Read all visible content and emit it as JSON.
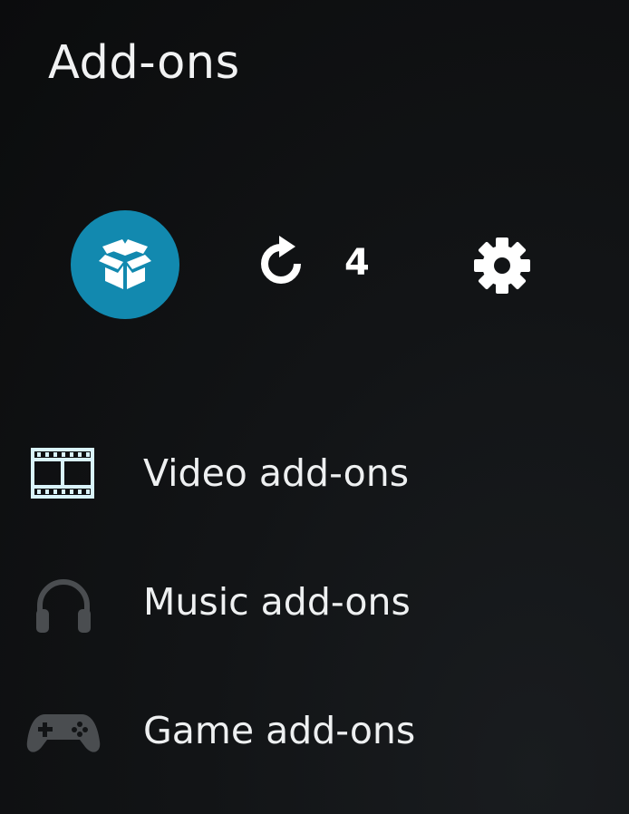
{
  "header": {
    "title": "Add-ons"
  },
  "toolbar": {
    "addon_browser_icon": "open-box-icon",
    "update_icon": "refresh-icon",
    "update_count": "4",
    "settings_icon": "gear-icon",
    "accent_color": "#1289af"
  },
  "menu": {
    "items": [
      {
        "label": "Video add-ons",
        "icon": "film-strip-icon"
      },
      {
        "label": "Music add-ons",
        "icon": "headphones-icon"
      },
      {
        "label": "Game add-ons",
        "icon": "gamepad-icon"
      }
    ]
  }
}
